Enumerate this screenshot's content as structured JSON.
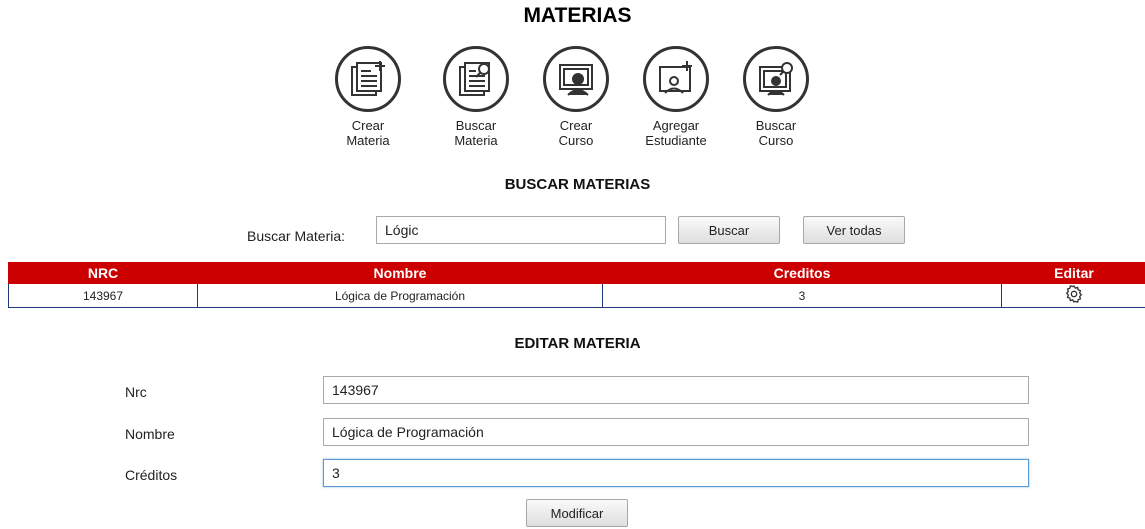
{
  "header": {
    "title": "MATERIAS"
  },
  "nav": [
    {
      "line1": "Crear",
      "line2": "Materia",
      "icon": "create-subject-icon"
    },
    {
      "line1": "Buscar",
      "line2": "Materia",
      "icon": "search-subject-icon"
    },
    {
      "line1": "Crear",
      "line2": "Curso",
      "icon": "create-course-icon"
    },
    {
      "line1": "Agregar",
      "line2": "Estudiante",
      "icon": "add-student-icon"
    },
    {
      "line1": "Buscar",
      "line2": "Curso",
      "icon": "search-course-icon"
    }
  ],
  "search": {
    "title": "BUSCAR MATERIAS",
    "label": "Buscar Materia:",
    "value": "Lógic",
    "search_button": "Buscar",
    "view_all_button": "Ver todas"
  },
  "results": {
    "columns": [
      "NRC",
      "Nombre",
      "Creditos",
      "Editar"
    ],
    "rows": [
      {
        "nrc": "143967",
        "nombre": "Lógica de Programación",
        "creditos": "3",
        "edit_icon": "gear-icon"
      }
    ]
  },
  "edit": {
    "title": "EDITAR MATERIA",
    "nrc_label": "Nrc",
    "nrc_value": "143967",
    "nombre_label": "Nombre",
    "nombre_value": "Lógica de Programación",
    "creditos_label": "Créditos",
    "creditos_value": "3",
    "submit_button": "Modificar"
  },
  "colors": {
    "table_header": "#cc0000",
    "table_border": "#1f3a7a",
    "focus_border": "#5b9bd5"
  }
}
